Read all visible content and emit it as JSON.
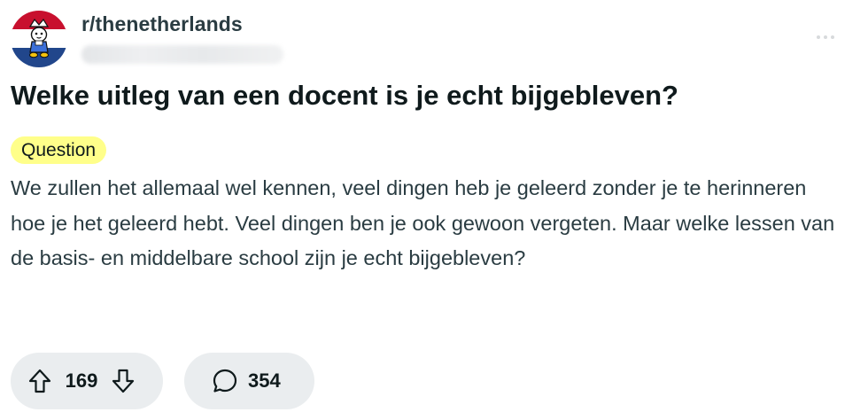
{
  "post": {
    "subreddit": "r/thenetherlands",
    "title": "Welke uitleg van een docent is je echt bijgebleven?",
    "flair": "Question",
    "body": "We zullen het allemaal wel kennen, veel dingen heb je geleerd zonder je te herinneren hoe je het geleerd hebt. Veel dingen ben je ook gewoon vergeten. Maar welke lessen van de basis- en middelbare school zijn je echt bijgebleven?",
    "votes": "169",
    "comments": "354"
  },
  "icons": {
    "avatar": "dutch-flag-mascot-icon",
    "menu": "more-horizontal-icon",
    "upvote": "upvote-arrow-icon",
    "downvote": "downvote-arrow-icon",
    "comment": "comment-bubble-icon"
  },
  "colors": {
    "flag_red": "#c8102e",
    "flag_white": "#ffffff",
    "flag_blue": "#21468b",
    "flair_bg": "#ffff8a",
    "pill_bg": "#eaedef",
    "text": "#0f1a1c",
    "secondary_text": "#2a3c42"
  }
}
